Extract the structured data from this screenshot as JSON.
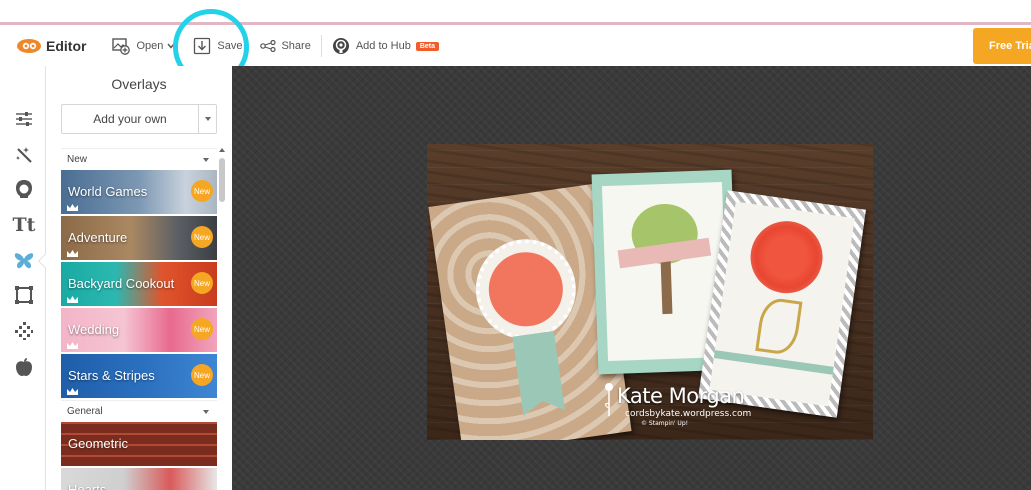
{
  "toolbar": {
    "editor_label": "Editor",
    "open_label": "Open",
    "save_label": "Save",
    "share_label": "Share",
    "hub_label": "Add to Hub",
    "beta_badge": "Beta",
    "free_trial_label": "Free Trial"
  },
  "sidebar": {
    "tools": [
      {
        "name": "adjust",
        "icon": "sliders-icon"
      },
      {
        "name": "effects",
        "icon": "magic-wand-icon"
      },
      {
        "name": "touch-up",
        "icon": "face-icon"
      },
      {
        "name": "text",
        "icon": "text-icon",
        "label": "Tt"
      },
      {
        "name": "overlays",
        "icon": "butterfly-icon",
        "active": true
      },
      {
        "name": "frames",
        "icon": "frame-icon"
      },
      {
        "name": "textures",
        "icon": "texture-icon"
      },
      {
        "name": "seasonal",
        "icon": "apple-icon"
      }
    ]
  },
  "panel": {
    "title": "Overlays",
    "add_own_label": "Add your own",
    "sections": [
      {
        "header": "New",
        "items": [
          {
            "label": "World Games",
            "badge": "New"
          },
          {
            "label": "Adventure",
            "badge": "New"
          },
          {
            "label": "Backyard Cookout",
            "badge": "New"
          },
          {
            "label": "Wedding",
            "badge": "New"
          },
          {
            "label": "Stars & Stripes",
            "badge": "New"
          }
        ]
      },
      {
        "header": "General",
        "items": [
          {
            "label": "Geometric"
          },
          {
            "label": "Hearts"
          }
        ]
      }
    ]
  },
  "photo": {
    "watermark_name": "Kate Morgan",
    "watermark_site": "cordsbykate.wordpress.com",
    "watermark_copy": "© Stampin' Up!"
  },
  "colors": {
    "accent_cyan": "#23d2e8",
    "free_trial_bg": "#f5a623",
    "beta_bg": "#f25b2a",
    "active_tool": "#5aaed8",
    "logo_orange": "#f0862a"
  }
}
